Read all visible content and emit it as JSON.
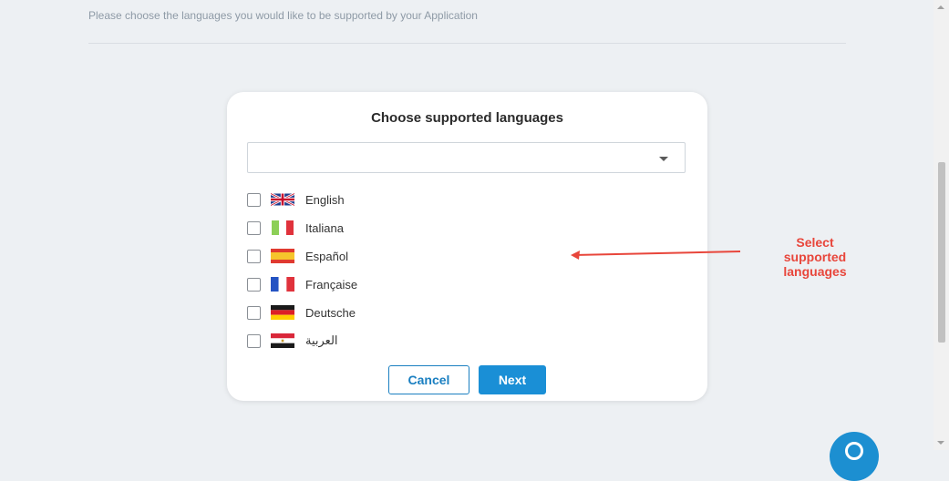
{
  "page": {
    "intro_text": "Please choose the languages you would like to be supported by your Application"
  },
  "dialog": {
    "title": "Choose supported languages",
    "dropdown_value": "",
    "languages": [
      {
        "label": "English",
        "flag": "uk-flag-icon",
        "checked": false
      },
      {
        "label": "Italiana",
        "flag": "italy-flag-icon",
        "checked": false
      },
      {
        "label": "Español",
        "flag": "spain-flag-icon",
        "checked": false
      },
      {
        "label": "Française",
        "flag": "france-flag-icon",
        "checked": false
      },
      {
        "label": "Deutsche",
        "flag": "germany-flag-icon",
        "checked": false
      },
      {
        "label": "العربية",
        "flag": "egypt-flag-icon",
        "checked": false
      }
    ],
    "cancel_label": "Cancel",
    "next_label": "Next"
  },
  "annotation": {
    "line1": "Select",
    "line2": "supported",
    "line3": "languages",
    "color": "#e8463b"
  },
  "colors": {
    "primary": "#1a8fd6",
    "background": "#edf0f3"
  }
}
